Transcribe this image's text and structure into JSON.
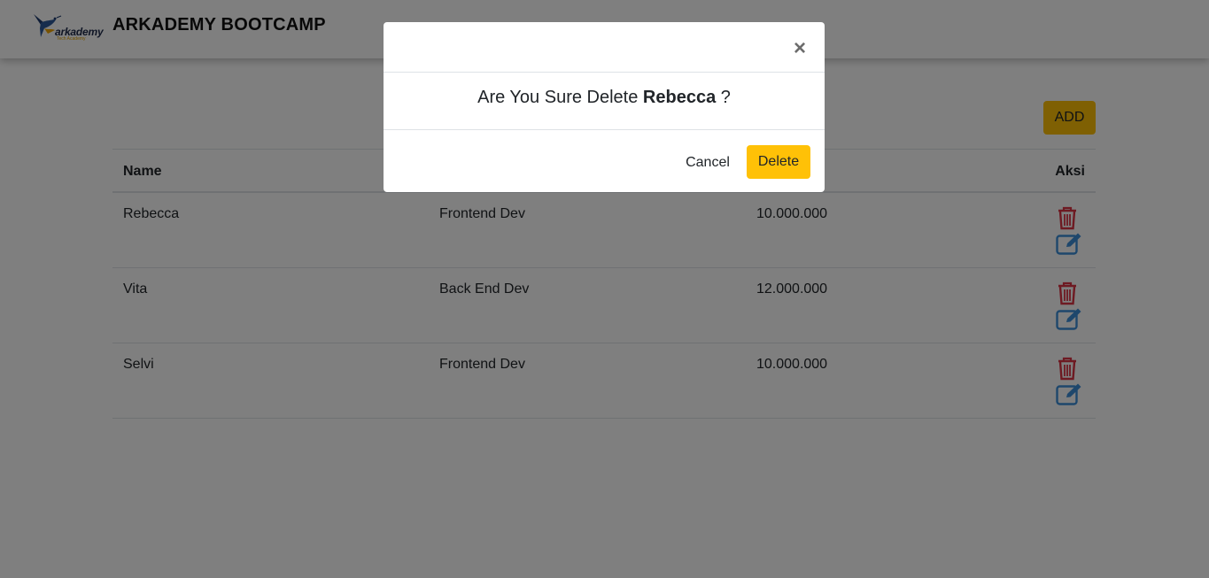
{
  "header": {
    "logo_text": "arkademy",
    "logo_subtext": "Tech Academy",
    "brand": "ARKADEMY BOOTCAMP"
  },
  "toolbar": {
    "add_label": "ADD"
  },
  "table": {
    "columns": [
      "Name",
      "",
      "",
      "Aksi"
    ],
    "rows": [
      {
        "name": "Rebecca",
        "job": "Frontend Dev",
        "salary": "10.000.000"
      },
      {
        "name": "Vita",
        "job": "Back End Dev",
        "salary": "12.000.000"
      },
      {
        "name": "Selvi",
        "job": "Frontend Dev",
        "salary": "10.000.000"
      }
    ]
  },
  "modal": {
    "close_symbol": "×",
    "message_prefix": "Are You Sure Delete",
    "target_name": "Rebecca",
    "message_suffix": "?",
    "cancel_label": "Cancel",
    "delete_label": "Delete"
  },
  "colors": {
    "accent": "#ffc107",
    "delete_icon": "#dc3545",
    "edit_icon": "#007bff"
  },
  "icons": {
    "delete": "trash-icon",
    "edit": "edit-icon"
  }
}
